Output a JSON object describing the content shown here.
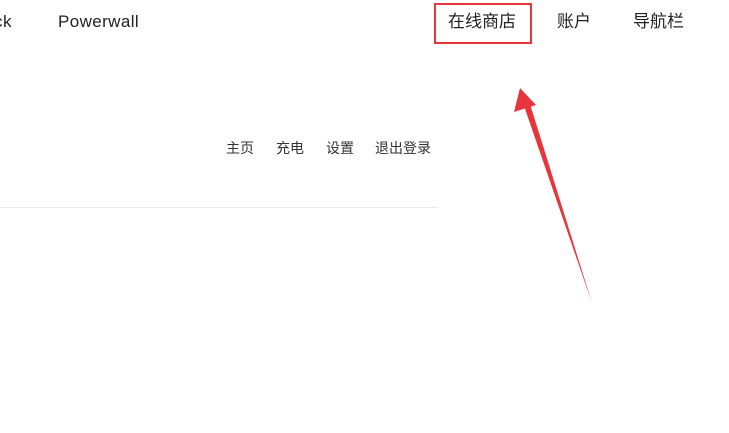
{
  "top_nav": {
    "truncated_item": "ck",
    "powerwall": "Powerwall",
    "online_shop": "在线商店",
    "account": "账户",
    "menu": "导航栏"
  },
  "sub_nav": {
    "home": "主页",
    "charging": "充电",
    "settings": "设置",
    "logout": "退出登录"
  },
  "annotation": {
    "highlight_color": "#e8353b",
    "arrow_color": "#e8353b"
  }
}
